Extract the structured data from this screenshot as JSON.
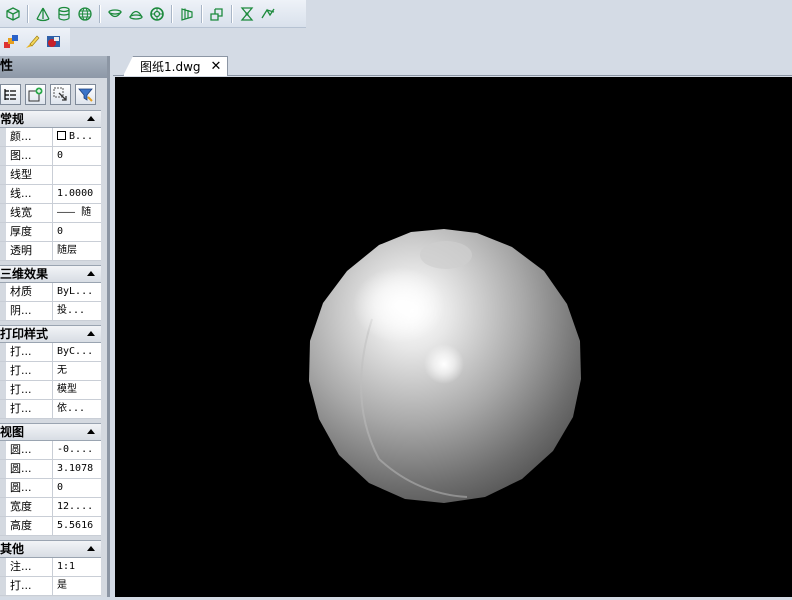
{
  "toolbar": {
    "icons": [
      "box-icon",
      "cone-icon",
      "cylinder-icon",
      "sphere-grid-icon",
      "dish-icon",
      "dome-icon",
      "torus-icon",
      "mesh-icon",
      "region-icon",
      "interfere-icon",
      "section-icon"
    ],
    "icons_row2": [
      "layers-icon",
      "brush-icon",
      "render-icon"
    ]
  },
  "properties": {
    "title": "性",
    "tools": [
      "tree-icon",
      "select-add-icon",
      "quick-select-icon",
      "filter-icon"
    ],
    "sections": [
      {
        "title": "常规",
        "rows": [
          {
            "name": "颜...",
            "value": "B...",
            "swatch": true
          },
          {
            "name": "图...",
            "value": "0"
          },
          {
            "name": "线型",
            "value": ""
          },
          {
            "name": "线...",
            "value": "1.0000"
          },
          {
            "name": "线宽",
            "value": "——— 随"
          },
          {
            "name": "厚度",
            "value": "0"
          },
          {
            "name": "透明",
            "value": "随层"
          }
        ]
      },
      {
        "title": "三维效果",
        "rows": [
          {
            "name": "材质",
            "value": "ByL..."
          },
          {
            "name": "阴...",
            "value": "投..."
          }
        ]
      },
      {
        "title": "打印样式",
        "rows": [
          {
            "name": "打...",
            "value": "ByC..."
          },
          {
            "name": "打...",
            "value": "无"
          },
          {
            "name": "打...",
            "value": "模型"
          },
          {
            "name": "打...",
            "value": "依..."
          }
        ]
      },
      {
        "title": "视图",
        "rows": [
          {
            "name": "圆...",
            "value": "-0...."
          },
          {
            "name": "圆...",
            "value": "3.1078"
          },
          {
            "name": "圆...",
            "value": "0"
          },
          {
            "name": "宽度",
            "value": "12...."
          },
          {
            "name": "高度",
            "value": "5.5616"
          }
        ]
      },
      {
        "title": "其他",
        "rows": [
          {
            "name": "注...",
            "value": "1:1"
          },
          {
            "name": "打...",
            "value": "是"
          }
        ]
      }
    ]
  },
  "tab": {
    "label": "图纸1.dwg",
    "close": "✕"
  },
  "viewport": {
    "background": "#000000",
    "object": "sphere-render"
  }
}
